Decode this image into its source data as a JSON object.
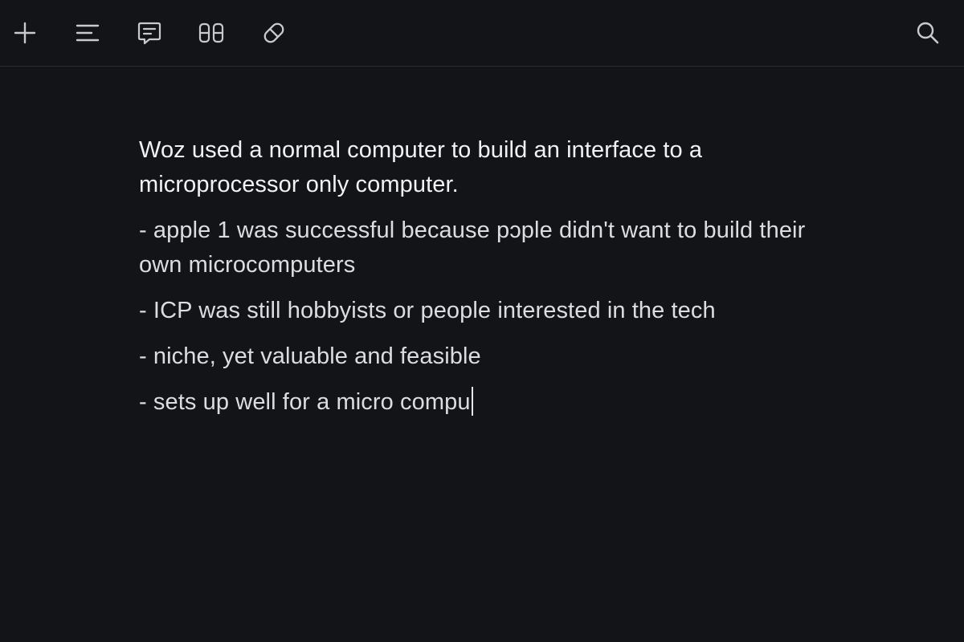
{
  "toolbar": {
    "left_icons": [
      "plus-icon",
      "outline-icon",
      "comment-icon",
      "panels-icon",
      "tag-icon"
    ],
    "right_icons": [
      "search-icon"
    ]
  },
  "document": {
    "lines": [
      "Woz used a normal computer to build an interface to a microprocessor only computer.",
      "- apple 1 was successful because pɔple didn't want to build their own microcomputers",
      "- ICP was still hobbyists or people interested in the tech",
      "- niche, yet valuable and feasible",
      "- sets up well for a micro compu"
    ]
  },
  "colors": {
    "background": "#131417",
    "text": "#dddde0",
    "icon": "#c9cacd",
    "divider": "#2a2c31"
  }
}
